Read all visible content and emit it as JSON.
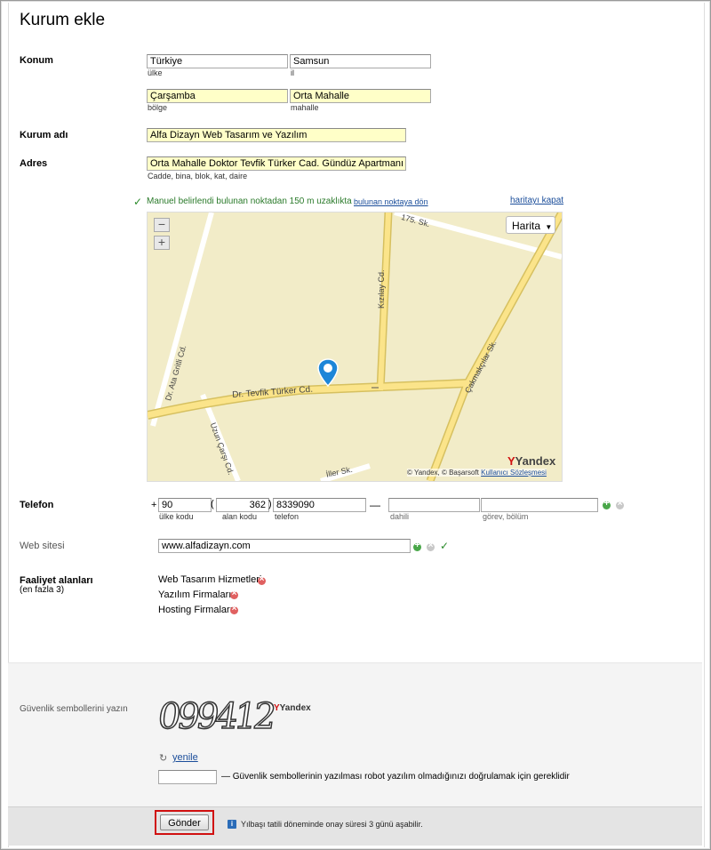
{
  "page_title": "Kurum ekle",
  "location": {
    "label": "Konum",
    "country": {
      "value": "Türkiye",
      "sub": "ülke"
    },
    "province": {
      "value": "Samsun",
      "sub": "il"
    },
    "district": {
      "value": "Çarşamba",
      "sub": "bölge"
    },
    "neighborhood": {
      "value": "Orta Mahalle",
      "sub": "mahalle"
    }
  },
  "org_name": {
    "label": "Kurum adı",
    "value": "Alfa Dizayn Web Tasarım ve Yazılım"
  },
  "address": {
    "label": "Adres",
    "value": "Orta Mahalle Doktor Tevfik Türker Cad. Gündüz Apartmanı Kat:1",
    "sub": "Cadde, bina, blok, kat, daire"
  },
  "map_notice": {
    "text": "Manuel belirlendi bulunan noktadan 150 m uzaklıkta",
    "return_link": "bulunan noktaya dön",
    "close_link": "haritayı kapat"
  },
  "map": {
    "type_button": "Harita",
    "zoom_out": "−",
    "zoom_in": "+",
    "streets": {
      "s175": "175. Sk.",
      "kizilay": "Kızılay Cd.",
      "ata": "Dr. Ata Gritli Cd.",
      "tevfik": "Dr. Tevfik Türker Cd.",
      "cakmak": "Çakmakçılar Sk.",
      "uzun": "Uzun Çarşı Cd.",
      "iller": "İller Sk."
    },
    "copyright": "© Yandex, © Başarsoft",
    "terms_link": "Kullanıcı Sözleşmesi",
    "logo": "Yandex"
  },
  "phone": {
    "label": "Telefon",
    "plus": "+",
    "country_code": {
      "value": "90",
      "sub": "ülke kodu"
    },
    "area_code": {
      "value": "362",
      "sub": "alan kodu"
    },
    "number": {
      "value": "8339090",
      "sub": "telefon"
    },
    "dash": "—",
    "ext": {
      "value": "",
      "sub": "dahili"
    },
    "role": {
      "value": "",
      "sub": "görev, bölüm"
    },
    "open_paren": "(",
    "close_paren": ")"
  },
  "website": {
    "label": "Web sitesi",
    "value": "www.alfadizayn.com"
  },
  "activities": {
    "label": "Faaliyet alanları",
    "sublabel": "(en fazla 3)",
    "items": [
      "Web Tasarım Hizmetleri",
      "Yazılım Firmaları",
      "Hosting Firmaları"
    ]
  },
  "captcha": {
    "label": "Güvenlik sembollerini yazın",
    "code": "099412",
    "brand": "Yandex",
    "refresh": "yenile",
    "input_value": "",
    "hint": "— Güvenlik sembollerinin yazılması robot yazılım olmadığınızı doğrulamak için gereklidir"
  },
  "submit": {
    "label": "Gönder",
    "info": "Yılbaşı tatili döneminde onay süresi 3 günü aşabilir."
  },
  "colors": {
    "accent_red": "#d01010",
    "link": "#1a4d9a",
    "success": "#2a8a2a",
    "highlight": "#ffffc8"
  }
}
